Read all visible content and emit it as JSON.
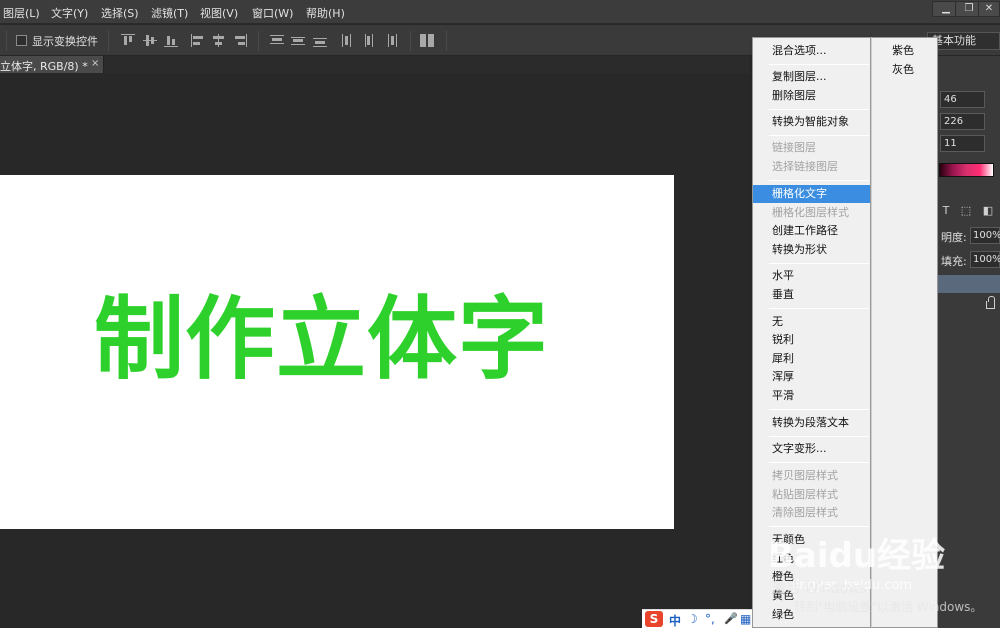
{
  "menubar": {
    "items": [
      "图层(L)",
      "文字(Y)",
      "选择(S)",
      "滤镜(T)",
      "视图(V)",
      "窗口(W)",
      "帮助(H)"
    ],
    "window_buttons": [
      "▁",
      "❐",
      "✕"
    ]
  },
  "options_bar": {
    "checkbox_label": "显示变换控件",
    "workspace": "基本功能"
  },
  "document_tab": {
    "title": "立体字, RGB/8) *",
    "close": "×"
  },
  "canvas": {
    "text": "制作立体字",
    "text_color": "#2ed12b"
  },
  "context_menu": {
    "items": [
      {
        "label": "混合选项...",
        "enabled": true
      },
      {
        "label": "复制图层...",
        "enabled": true
      },
      {
        "label": "删除图层",
        "enabled": true
      },
      {
        "label": "转换为智能对象",
        "enabled": true
      },
      {
        "label": "链接图层",
        "enabled": false
      },
      {
        "label": "选择链接图层",
        "enabled": false
      },
      {
        "label": "栅格化文字",
        "enabled": true,
        "highlighted": true
      },
      {
        "label": "栅格化图层样式",
        "enabled": false
      },
      {
        "label": "创建工作路径",
        "enabled": true
      },
      {
        "label": "转换为形状",
        "enabled": true
      },
      {
        "label": "水平",
        "enabled": true
      },
      {
        "label": "垂直",
        "enabled": true
      },
      {
        "label": "无",
        "enabled": true
      },
      {
        "label": "锐利",
        "enabled": true
      },
      {
        "label": "犀利",
        "enabled": true
      },
      {
        "label": "浑厚",
        "enabled": true
      },
      {
        "label": "平滑",
        "enabled": true
      },
      {
        "label": "转换为段落文本",
        "enabled": true
      },
      {
        "label": "文字变形...",
        "enabled": true
      },
      {
        "label": "拷贝图层样式",
        "enabled": false
      },
      {
        "label": "粘贴图层样式",
        "enabled": false
      },
      {
        "label": "清除图层样式",
        "enabled": false
      },
      {
        "label": "无颜色",
        "enabled": true
      },
      {
        "label": "红色",
        "enabled": true
      },
      {
        "label": "橙色",
        "enabled": true
      },
      {
        "label": "黄色",
        "enabled": true
      },
      {
        "label": "绿色",
        "enabled": true
      }
    ],
    "highlight_color": "#3a8de0"
  },
  "submenu": {
    "items": [
      "紫色",
      "灰色"
    ]
  },
  "right_panel": {
    "color_values": [
      "46",
      "226",
      "11"
    ],
    "opacity_label": "明度:",
    "opacity_value": "100%",
    "fill_label": "填充:",
    "fill_value": "100%",
    "tool_icons": [
      "T",
      "⬚",
      "◧"
    ]
  },
  "watermark": {
    "logo": "Baidu经验",
    "url": "jingyan.baidu.com",
    "windows_title": "激活 Windows",
    "windows_sub": "转到\"电脑设置\"以激活 Windows。"
  },
  "ime": {
    "glyphs": [
      "S",
      "中",
      "☽",
      "°,",
      "🎤",
      "▦"
    ]
  }
}
